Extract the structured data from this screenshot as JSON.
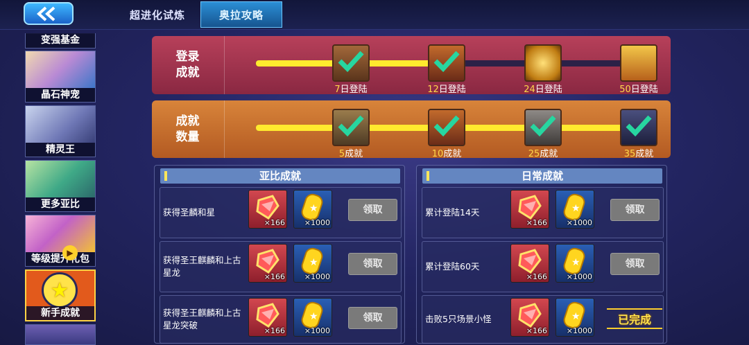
{
  "tabs": [
    "超进化试炼",
    "奥拉攻略"
  ],
  "sidebar": {
    "items": [
      {
        "label": "变强基金"
      },
      {
        "label": "晶石神宠"
      },
      {
        "label": "精灵王"
      },
      {
        "label": "更多亚比"
      },
      {
        "label": "等级提升礼包"
      },
      {
        "label": "新手成就"
      }
    ]
  },
  "login_panel": {
    "title_line1": "登录",
    "title_line2": "成就",
    "progress": 0.46,
    "milestones": [
      {
        "num": "7",
        "suffix": "日登陆",
        "claimed": true
      },
      {
        "num": "12",
        "suffix": "日登陆",
        "claimed": true
      },
      {
        "num": "24",
        "suffix": "日登陆",
        "claimed": false
      },
      {
        "num": "50",
        "suffix": "日登陆",
        "claimed": false
      }
    ]
  },
  "count_panel": {
    "title_line1": "成就",
    "title_line2": "数量",
    "progress": 1.0,
    "milestones": [
      {
        "num": "5",
        "suffix": "成就",
        "claimed": true
      },
      {
        "num": "10",
        "suffix": "成就",
        "claimed": true
      },
      {
        "num": "25",
        "suffix": "成就",
        "claimed": true
      },
      {
        "num": "35",
        "suffix": "成就",
        "claimed": true
      }
    ]
  },
  "yabi_section": {
    "title": "亚比成就",
    "rows": [
      {
        "text": "获得圣麟和星",
        "qty1": "×166",
        "qty2": "×1000",
        "action": "领取"
      },
      {
        "text": "获得圣王麒麟和上古星龙",
        "qty1": "×166",
        "qty2": "×1000",
        "action": "领取"
      },
      {
        "text": "获得圣王麒麟和上古星龙突破",
        "qty1": "×166",
        "qty2": "×1000",
        "action": "领取"
      }
    ]
  },
  "daily_section": {
    "title": "日常成就",
    "rows": [
      {
        "text": "累计登陆14天",
        "qty1": "×166",
        "qty2": "×1000",
        "action": "领取"
      },
      {
        "text": "累计登陆60天",
        "qty1": "×166",
        "qty2": "×1000",
        "action": "领取"
      },
      {
        "text": "击败5只场景小怪",
        "qty1": "×166",
        "qty2": "×1000",
        "action": "已完成"
      }
    ]
  },
  "colors": {
    "accent_yellow": "#ffea2e",
    "check_green": "#27d6a0",
    "claim_gray": "#7a7a7a"
  }
}
